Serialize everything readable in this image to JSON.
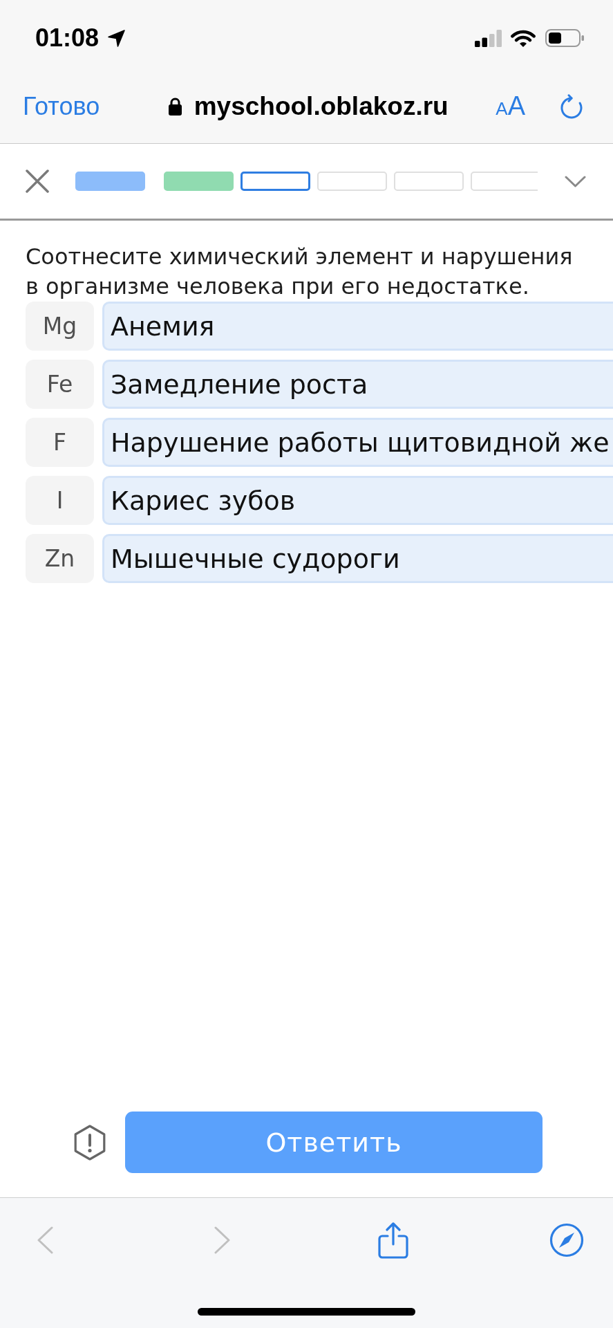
{
  "status_bar": {
    "time": "01:08"
  },
  "browser_bar": {
    "done": "Готово",
    "url": "myschool.oblakoz.ru",
    "text_size": [
      "A",
      "A"
    ]
  },
  "progress": {
    "segments": [
      {
        "selected": false,
        "color": "#8cbcfa"
      },
      {
        "selected": false,
        "color": "#90dbb0"
      },
      {
        "selected": true
      },
      {
        "selected": false
      },
      {
        "selected": false
      },
      {
        "selected": false
      }
    ]
  },
  "question": {
    "prompt": "Соотнесите химический элемент и нарушения в организме человека при его недостатке.",
    "pairs": [
      {
        "element": "Mg",
        "answer": "Анемия"
      },
      {
        "element": "Fe",
        "answer": "Замедление роста"
      },
      {
        "element": "F",
        "answer": "Нарушение работы щитовидной же"
      },
      {
        "element": "I",
        "answer": "Кариес зубов"
      },
      {
        "element": "Zn",
        "answer": "Мышечные судороги"
      }
    ]
  },
  "answer_button": {
    "label": "Ответить"
  },
  "browser_toolbar": {
    "back": {
      "disabled": true
    },
    "forward": {
      "disabled": true
    }
  }
}
